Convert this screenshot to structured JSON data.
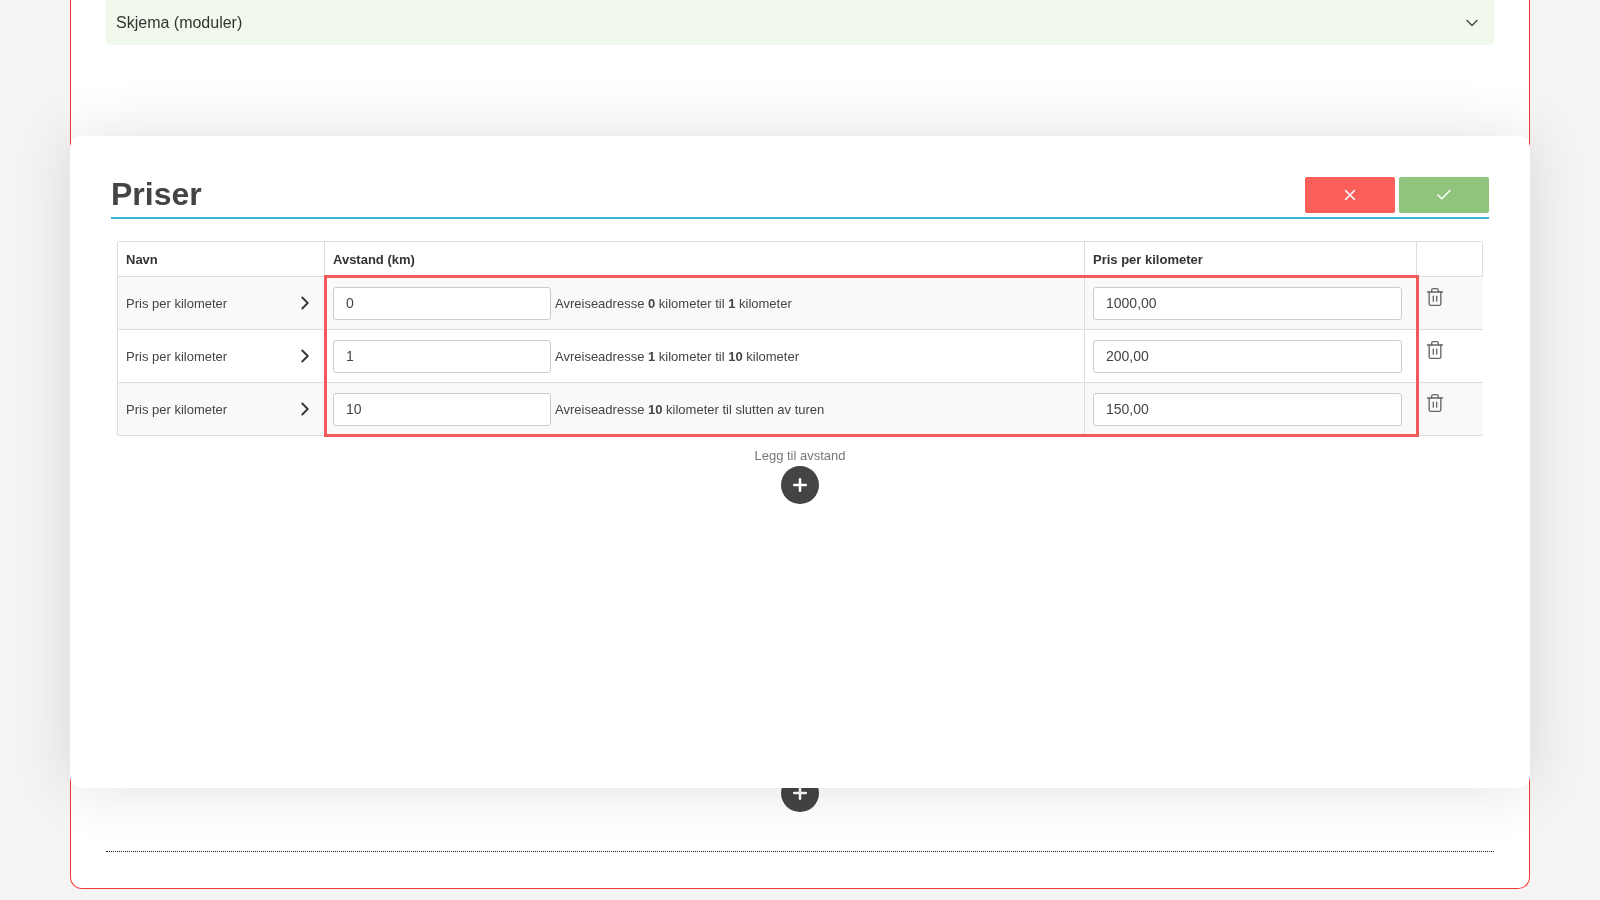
{
  "accordion": {
    "title": "Skjema (moduler)",
    "expanded": false
  },
  "modal": {
    "title": "Priser",
    "table": {
      "highlighted": true,
      "columns": [
        "Navn",
        "Avstand (km)",
        "Pris per kilometer"
      ],
      "rows": [
        {
          "name": "Pris per kilometer",
          "distance": "0",
          "description": "Avreiseadresse **0** kilometer til **1** kilometer",
          "price": "1000,00"
        },
        {
          "name": "Pris per kilometer",
          "distance": "1",
          "description": "Avreiseadresse **1** kilometer til **10** kilometer",
          "price": "200,00"
        },
        {
          "name": "Pris per kilometer",
          "distance": "10",
          "description": "Avreiseadresse **10** kilometer til slutten av turen",
          "price": "150,00"
        }
      ]
    },
    "add_label": "Legg til avstand"
  }
}
